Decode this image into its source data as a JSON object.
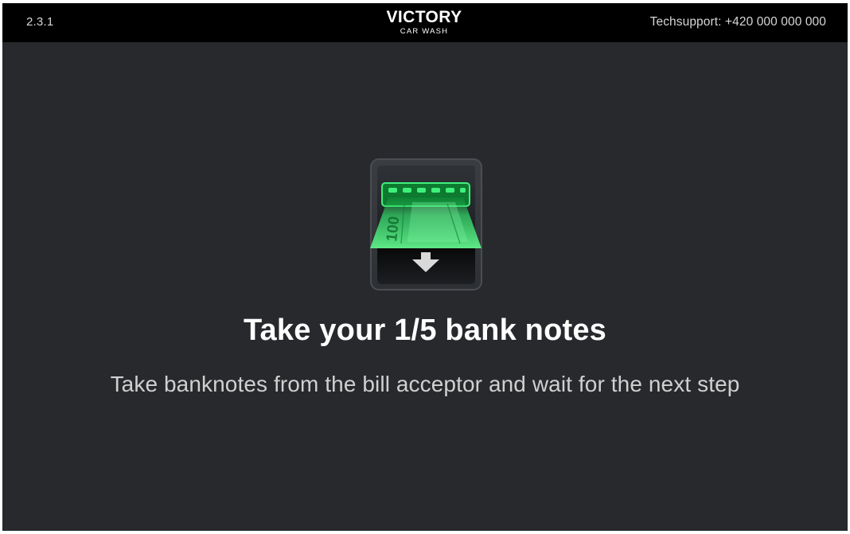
{
  "header": {
    "version": "2.3.1",
    "logo": {
      "name": "VICTORY",
      "tagline": "CAR WASH"
    },
    "techsupport": "Techsupport: +420 000 000 000"
  },
  "main": {
    "icon": "bill-acceptor-take-banknote-icon",
    "banknote_denomination": "100",
    "title": "Take your 1/5 bank notes",
    "subtitle": "Take banknotes from the bill acceptor and wait for the next step"
  },
  "colors": {
    "background": "#27292c",
    "header": "#000000",
    "banknote_green": "#2fd162",
    "logo_accent": "#e21b23"
  }
}
